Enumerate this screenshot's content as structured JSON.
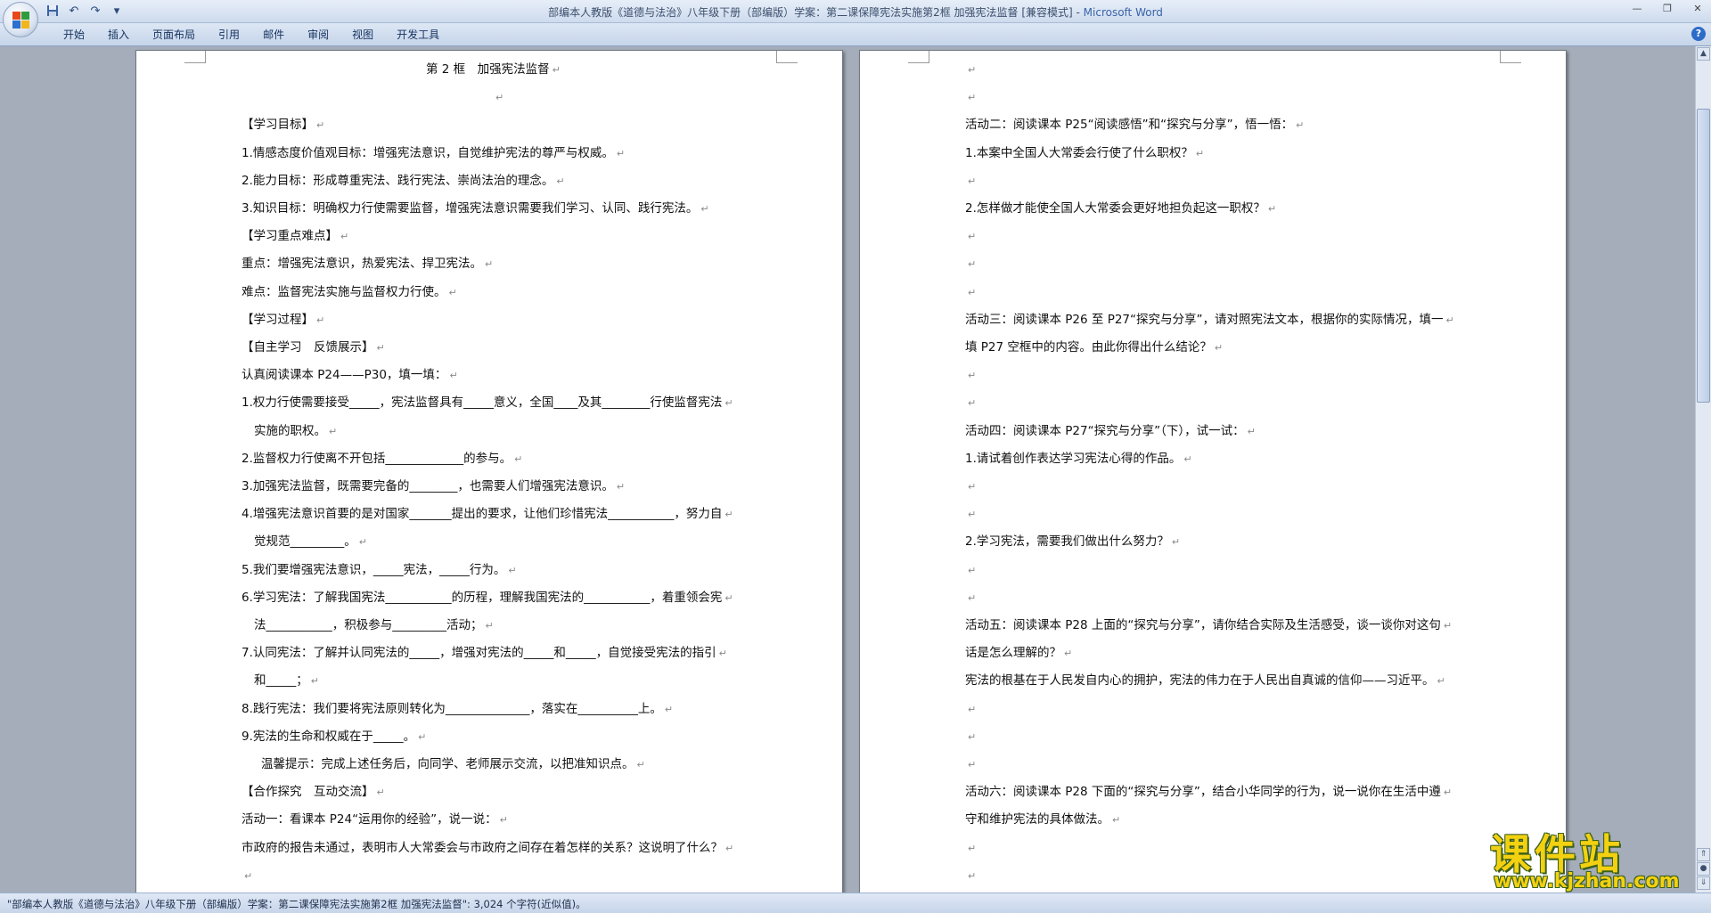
{
  "window": {
    "title_doc": "部编本人教版《道德与法治》八年级下册（部编版）学案：第二课保障宪法实施第2框 加强宪法监督 [兼容模式] - ",
    "title_app": "Microsoft Word"
  },
  "ribbon": {
    "tabs": [
      "开始",
      "插入",
      "页面布局",
      "引用",
      "邮件",
      "审阅",
      "视图",
      "开发工具"
    ]
  },
  "colors": {
    "office_logo": [
      "#e8471c",
      "#2e9c3f",
      "#2b6fcf",
      "#f2b51a"
    ],
    "watermark": "#f3d111"
  },
  "icons": {
    "office_button": "office-logo-icon",
    "save": "save-icon",
    "undo": "undo-icon",
    "redo": "redo-icon",
    "customize": "customize-qat-icon",
    "help": "help-icon"
  },
  "page_left": {
    "lines": [
      "第 2 框　加强宪法监督",
      "",
      "【学习目标】",
      "1.情感态度价值观目标：增强宪法意识，自觉维护宪法的尊严与权威。",
      "2.能力目标：形成尊重宪法、践行宪法、崇尚法治的理念。",
      "3.知识目标：明确权力行使需要监督，增强宪法意识需要我们学习、认同、践行宪法。",
      "【学习重点难点】",
      "重点：增强宪法意识，热爱宪法、捍卫宪法。",
      "难点：监督宪法实施与监督权力行使。",
      "【学习过程】",
      "【自主学习　反馈展示】",
      "认真阅读课本 P24——P30，填一填：",
      "1.权力行使需要接受_____，宪法监督具有_____意义，全国____及其________行使监督宪法",
      "实施的职权。",
      "2.监督权力行使离不开包括_____________的参与。",
      "3.加强宪法监督，既需要完备的________，也需要人们增强宪法意识。",
      "4.增强宪法意识首要的是对国家_______提出的要求，让他们珍惜宪法___________，努力自",
      "觉规范_________。",
      "5.我们要增强宪法意识，_____宪法，_____行为。",
      "6.学习宪法：了解我国宪法___________的历程，理解我国宪法的___________，着重领会宪",
      "法___________，积极参与_________活动；",
      "7.认同宪法：了解并认同宪法的_____，增强对宪法的_____和_____，自觉接受宪法的指引",
      "和_____；",
      "8.践行宪法：我们要将宪法原则转化为______________，落实在__________上。",
      "9.宪法的生命和权威在于_____。",
      "温馨提示：完成上述任务后，向同学、老师展示交流，以把准知识点。",
      "【合作探究　互动交流】",
      "活动一：看课本 P24“运用你的经验”，说一说：",
      "市政府的报告未通过，表明市人大常委会与市政府之间存在着怎样的关系？这说明了什么？",
      ""
    ]
  },
  "page_right": {
    "lines": [
      "",
      "",
      "活动二：阅读课本 P25“阅读感悟”和“探究与分享”，悟一悟：",
      "1.本案中全国人大常委会行使了什么职权？",
      "",
      "2.怎样做才能使全国人大常委会更好地担负起这一职权？",
      "",
      "",
      "",
      "活动三：阅读课本 P26 至 P27“探究与分享”，请对照宪法文本，根据你的实际情况，填一",
      "填 P27 空框中的内容。由此你得出什么结论？",
      "",
      "",
      "活动四：阅读课本 P27“探究与分享”（下），试一试：",
      "1.请试着创作表达学习宪法心得的作品。",
      "",
      "",
      "2.学习宪法，需要我们做出什么努力？",
      "",
      "",
      "活动五：阅读课本 P28 上面的“探究与分享”，请你结合实际及生活感受，谈一谈你对这句",
      "话是怎么理解的？",
      "宪法的根基在于人民发自内心的拥护，宪法的伟力在于人民出自真诚的信仰——习近平。",
      "",
      "",
      "",
      "活动六：阅读课本 P28 下面的“探究与分享”，结合小华同学的行为，说一说你在生活中遵",
      "守和维护宪法的具体做法。",
      "",
      ""
    ]
  },
  "status": {
    "text": "\"部编本人教版《道德与法治》八年级下册（部编版）学案：第二课保障宪法实施第2框 加强宪法监督\": 3,024 个字符(近似值)。"
  },
  "watermark": {
    "title": "课件站",
    "url": "www.kjzhan.com"
  }
}
